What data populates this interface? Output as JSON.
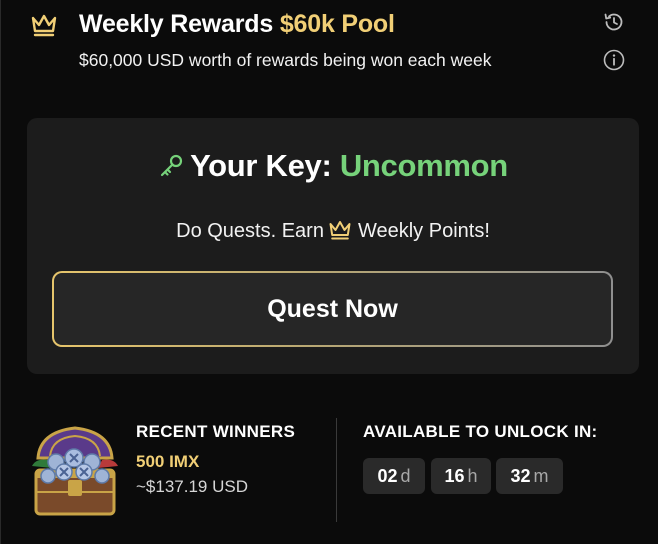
{
  "header": {
    "title": "Weekly Rewards",
    "title_highlight": "$60k Pool",
    "subtitle": "$60,000 USD worth of rewards being won each week",
    "icons": [
      "crown-icon",
      "history-icon",
      "info-icon"
    ]
  },
  "key_card": {
    "key_label": "Your Key:",
    "key_value": "Uncommon",
    "quest_text_before": "Do Quests. Earn",
    "quest_text_after": "Weekly Points!",
    "button_label": "Quest Now"
  },
  "recent_winners": {
    "label": "RECENT WINNERS",
    "amount": "500 IMX",
    "usd": "~$137.19 USD"
  },
  "unlock": {
    "label": "AVAILABLE TO UNLOCK IN:",
    "days": "02",
    "days_unit": "d",
    "hours": "16",
    "hours_unit": "h",
    "minutes": "32",
    "minutes_unit": "m"
  },
  "colors": {
    "gold": "#f1cf76",
    "green": "#76d27a",
    "background": "#0b0b0b",
    "card": "#1c1c1c"
  }
}
